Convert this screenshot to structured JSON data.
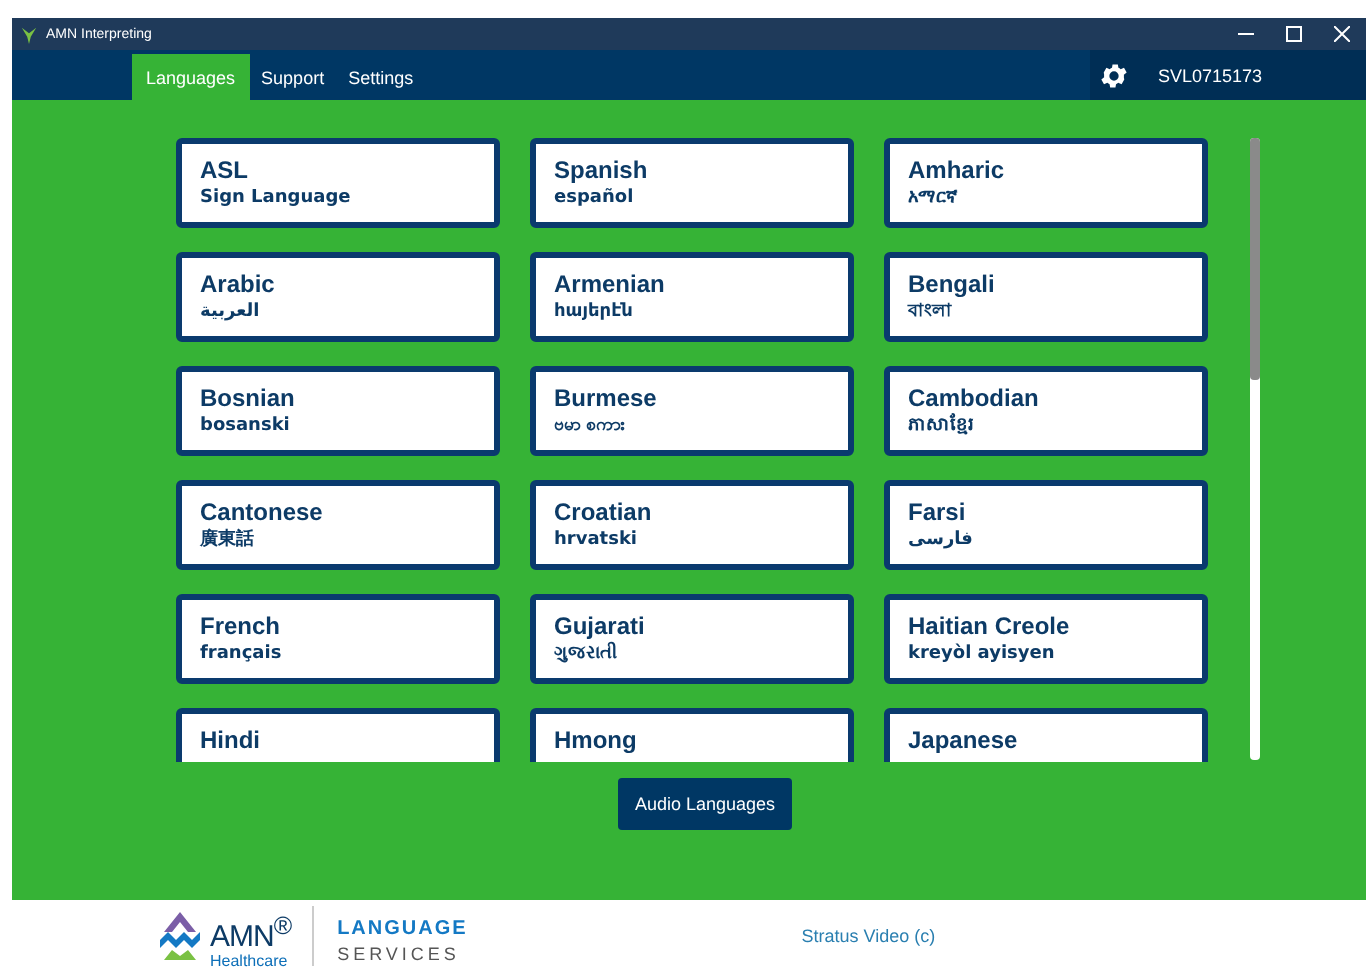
{
  "window": {
    "title": "AMN Interpreting"
  },
  "tabs": [
    {
      "label": "Languages",
      "selected": true
    },
    {
      "label": "Support",
      "selected": false
    },
    {
      "label": "Settings",
      "selected": false
    }
  ],
  "user": {
    "id": "SVL0715173"
  },
  "languages": [
    {
      "name": "ASL",
      "native": "Sign Language"
    },
    {
      "name": "Spanish",
      "native": "español"
    },
    {
      "name": "Amharic",
      "native": "አማርኛ"
    },
    {
      "name": "Arabic",
      "native": "العربية"
    },
    {
      "name": "Armenian",
      "native": "հայերէն"
    },
    {
      "name": "Bengali",
      "native": "বাংলা"
    },
    {
      "name": "Bosnian",
      "native": "bosanski"
    },
    {
      "name": "Burmese",
      "native": "ဗမာ စကား"
    },
    {
      "name": "Cambodian",
      "native": "ភាសាខ្មែរ"
    },
    {
      "name": "Cantonese",
      "native": "廣東話"
    },
    {
      "name": "Croatian",
      "native": "hrvatski"
    },
    {
      "name": "Farsi",
      "native": "فارسی"
    },
    {
      "name": "French",
      "native": "français"
    },
    {
      "name": "Gujarati",
      "native": "ગુજરાતી"
    },
    {
      "name": "Haitian Creole",
      "native": "kreyòl ayisyen"
    },
    {
      "name": "Hindi"
    },
    {
      "name": "Hmong"
    },
    {
      "name": "Japanese"
    }
  ],
  "audio_button": "Audio Languages",
  "footer": {
    "brand": "AMN$^{®}$",
    "brand_sub": "Healthcare",
    "service_line1": "LANGUAGE",
    "service_line2": "SERVICES",
    "credit": "Stratus Video (c)"
  }
}
